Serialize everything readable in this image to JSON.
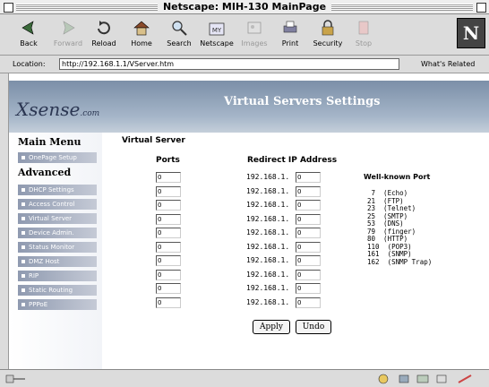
{
  "window": {
    "title": "Netscape: MIH-130 MainPage"
  },
  "toolbar": {
    "back": "Back",
    "forward": "Forward",
    "reload": "Reload",
    "home": "Home",
    "search": "Search",
    "netscape": "Netscape",
    "images": "Images",
    "print": "Print",
    "security": "Security",
    "stop": "Stop"
  },
  "location": {
    "label": "Location:",
    "url": "http://192.168.1.1/VServer.htm",
    "related": "What's Related"
  },
  "header": {
    "logo": "Xsense",
    "logo_suffix": ".com",
    "title": "Virtual Servers Settings"
  },
  "sidebar": {
    "main_menu": "Main Menu",
    "onepage": "OnePage Setup",
    "advanced": "Advanced",
    "items": [
      "DHCP Settings",
      "Access Control",
      "Virtual Server",
      "Device Admin.",
      "Status Monitor",
      "DMZ Host",
      "RIP",
      "Static Routing",
      "PPPoE"
    ]
  },
  "form": {
    "heading": "Virtual Server",
    "ports_header": "Ports",
    "ip_header": "Redirect IP Address",
    "ip_prefix": "192.168.1.",
    "rows": [
      {
        "port": "0",
        "ip": "0"
      },
      {
        "port": "0",
        "ip": "0"
      },
      {
        "port": "0",
        "ip": "0"
      },
      {
        "port": "0",
        "ip": "0"
      },
      {
        "port": "0",
        "ip": "0"
      },
      {
        "port": "0",
        "ip": "0"
      },
      {
        "port": "0",
        "ip": "0"
      },
      {
        "port": "0",
        "ip": "0"
      },
      {
        "port": "0",
        "ip": "0"
      },
      {
        "port": "0",
        "ip": "0"
      }
    ],
    "apply": "Apply",
    "undo": "Undo"
  },
  "well_known": {
    "title": "Well-known Port",
    "ports": [
      " 7  (Echo)",
      "21  (FTP)",
      "23  (Telnet)",
      "25  (SMTP)",
      "53  (DNS)",
      "79  (finger)",
      "80  (HTTP)",
      "110  (POP3)",
      "161  (SNMP)",
      "162  (SNMP Trap)"
    ]
  }
}
